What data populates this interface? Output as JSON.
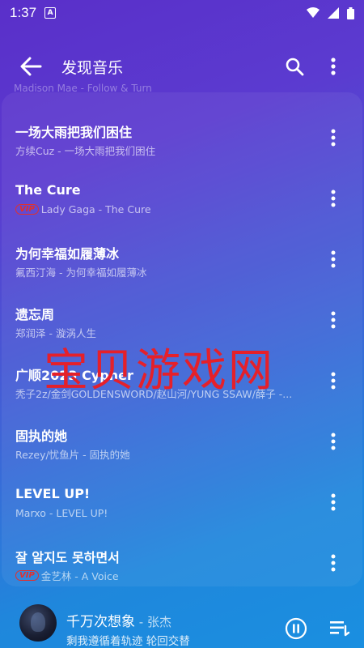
{
  "status": {
    "time": "1:37",
    "a_badge": "A"
  },
  "appbar": {
    "title": "发现音乐"
  },
  "top_partial": "Madison Mae - Follow & Turn",
  "songs": [
    {
      "title": "一场大雨把我们困住",
      "subtitle": "方续Cuz - 一场大雨把我们困住",
      "vip": false
    },
    {
      "title": "The Cure",
      "subtitle": "Lady Gaga - The Cure",
      "vip": true
    },
    {
      "title": "为何幸福如履薄冰",
      "subtitle": "氟西汀海 - 为何幸福如履薄冰",
      "vip": false
    },
    {
      "title": "遗忘周",
      "subtitle": "郑润泽 - 漩涡人生",
      "vip": false
    },
    {
      "title": "广顺2023 Cypher",
      "subtitle": "秃子2z/金剑GOLDENSWORD/赵山河/YUNG SSAW/薛子 -...",
      "vip": false
    },
    {
      "title": "固执的她",
      "subtitle": "Rezey/忧鱼片 - 固执的她",
      "vip": false
    },
    {
      "title": "LEVEL UP!",
      "subtitle": "Marxo - LEVEL UP!",
      "vip": false
    },
    {
      "title": "잘 알지도 못하면서",
      "subtitle": "金艺林 - A Voice",
      "vip": true
    }
  ],
  "vip_label": "VIP",
  "watermark": "宝贝游戏网",
  "player": {
    "title": "千万次想象",
    "separator": " - ",
    "artist": "张杰",
    "lyric": "剩我遵循着轨迹 轮回交替"
  },
  "icons": {
    "back": "arrow-left-icon",
    "search": "search-icon",
    "more": "more-vertical-icon",
    "pause": "pause-circle-icon",
    "queue": "playlist-icon"
  }
}
